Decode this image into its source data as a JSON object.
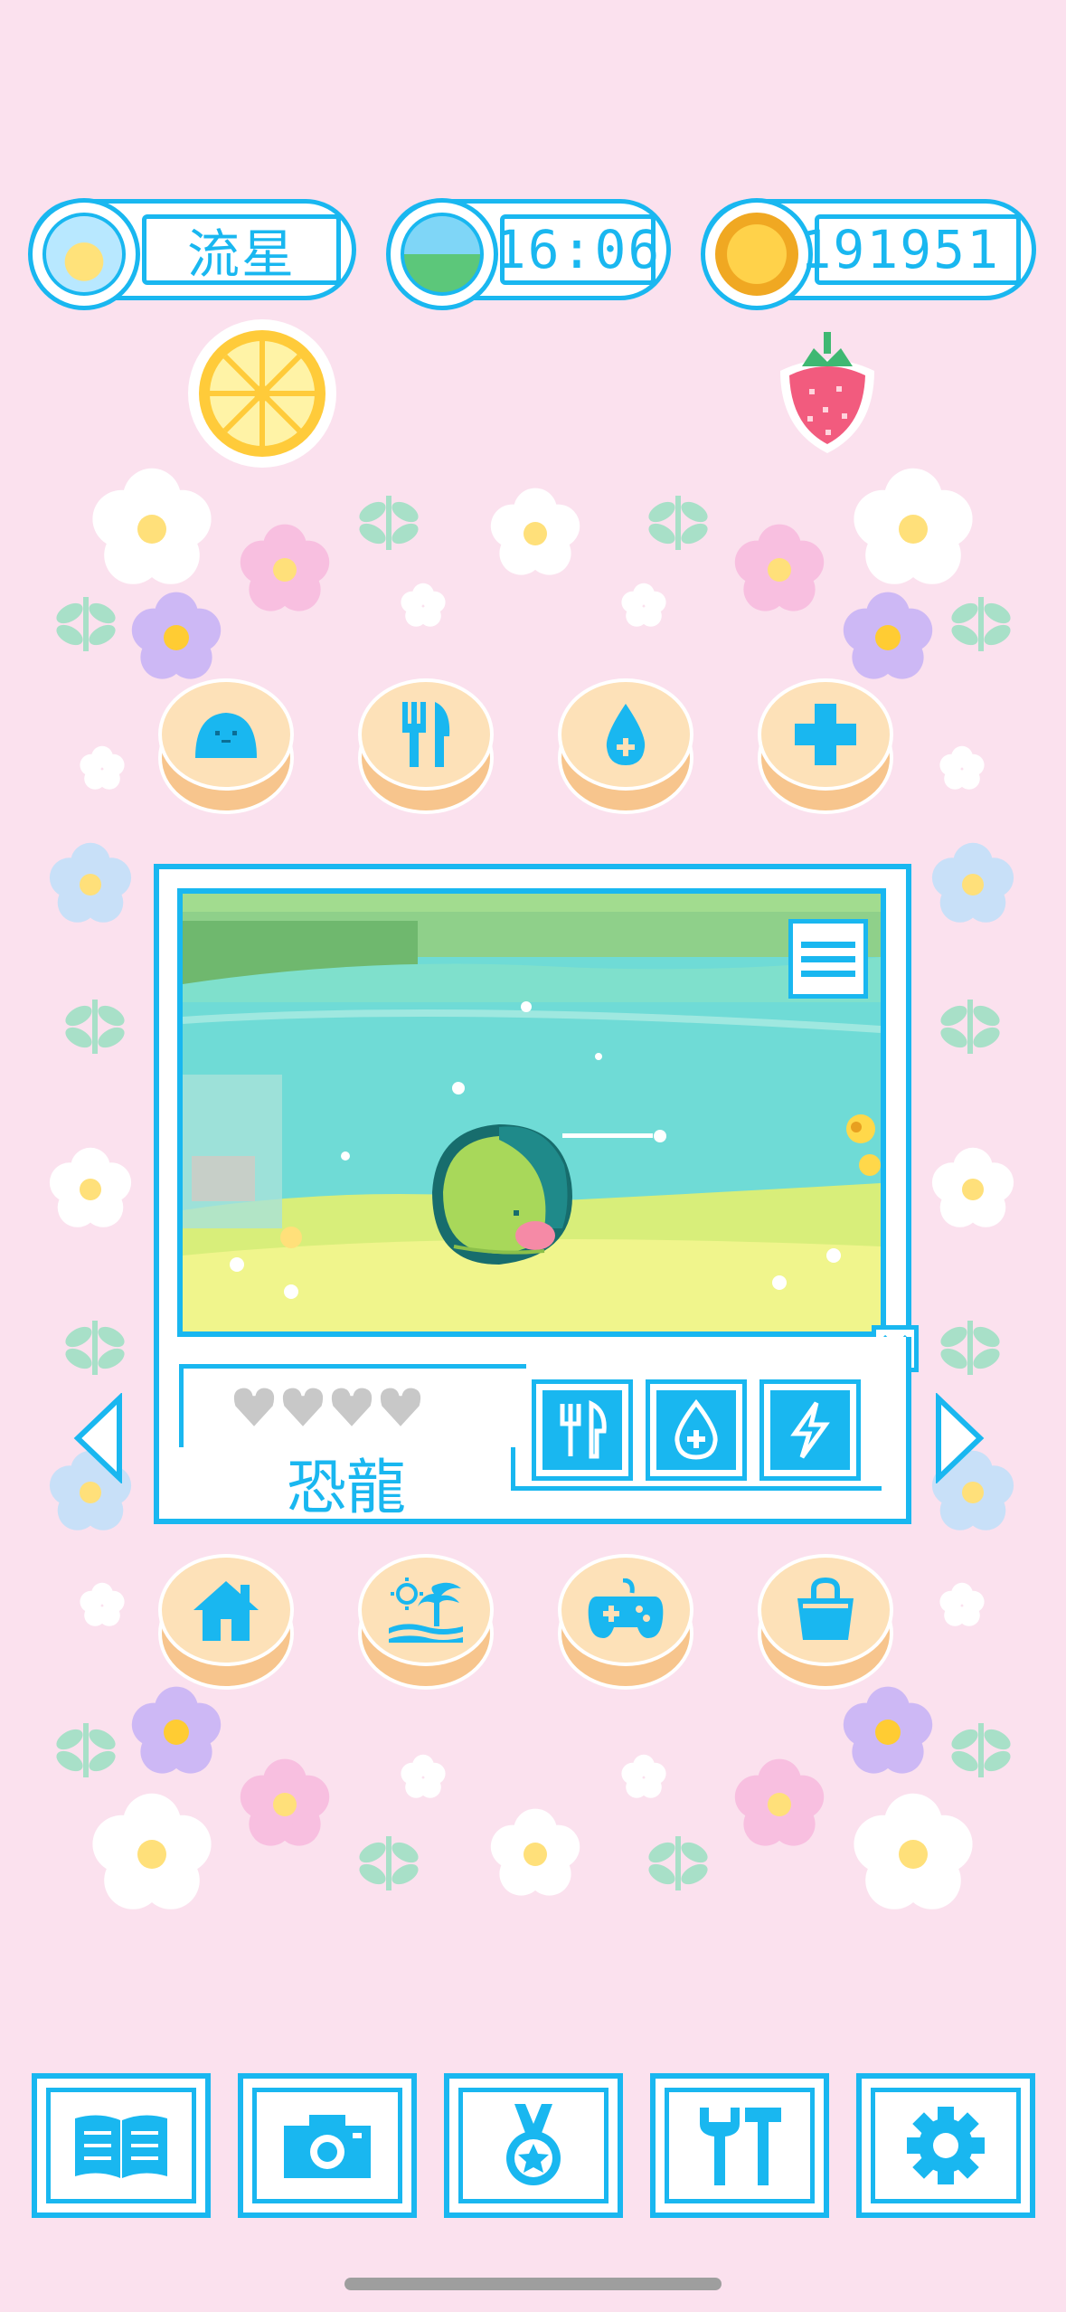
{
  "status": {
    "pet_name": "流星",
    "clock": "16:06",
    "coins": "191951"
  },
  "pet": {
    "name": "恐龍",
    "hearts_filled": 0,
    "hearts_total": 4
  },
  "colors": {
    "accent": "#19b7f0",
    "background": "#fbe1ee",
    "button_cream": "#fde1b8",
    "button_shadow": "#f7c58d"
  },
  "icons": {
    "top_actions": [
      "slime-icon",
      "fork-knife-icon",
      "water-drop-icon",
      "plus-icon"
    ],
    "bottom_actions": [
      "house-icon",
      "beach-icon",
      "gamepad-icon",
      "bag-icon"
    ],
    "stats": [
      "food-stat-icon",
      "water-stat-icon",
      "energy-stat-icon"
    ],
    "toolbar": [
      "book-icon",
      "camera-icon",
      "medal-icon",
      "tools-icon",
      "gear-icon"
    ]
  }
}
